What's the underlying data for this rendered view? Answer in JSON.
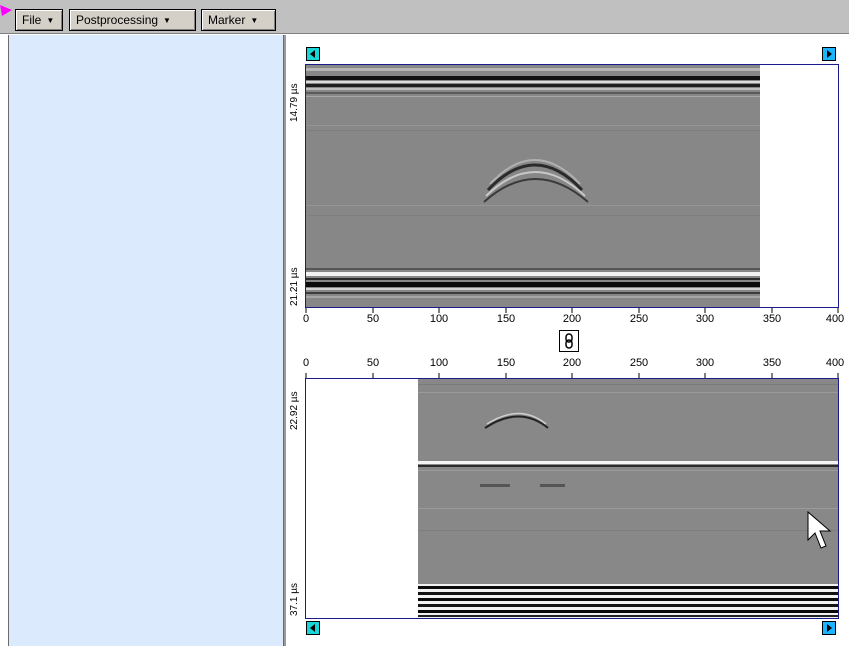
{
  "toolbar": {
    "menus": [
      {
        "label": "File"
      },
      {
        "label": "Postprocessing"
      },
      {
        "label": "Marker"
      }
    ]
  },
  "panel_top": {
    "x_ticks": [
      "0",
      "50",
      "100",
      "150",
      "200",
      "250",
      "300",
      "350",
      "400"
    ],
    "time_start": "14.79 µs",
    "time_end": "21.21 µs"
  },
  "panel_bottom": {
    "x_ticks": [
      "0",
      "50",
      "100",
      "150",
      "200",
      "250",
      "300",
      "350",
      "400"
    ],
    "time_start": "22.92 µs",
    "time_end": "37.1 µs"
  },
  "icons": {
    "scroll_left": "scroll-left-icon",
    "scroll_right": "scroll-right-icon",
    "link": "link-icon",
    "pointer": "mouse-pointer-icon"
  },
  "colors": {
    "sidebar_bg": "#dbeafc",
    "toolbar_bg": "#c0c0c0",
    "frame": "#1b1b8a",
    "arrow_cyan": "#19d6d6",
    "arrow_blue": "#1ab4ff",
    "marker_pink": "#ff00ff"
  }
}
